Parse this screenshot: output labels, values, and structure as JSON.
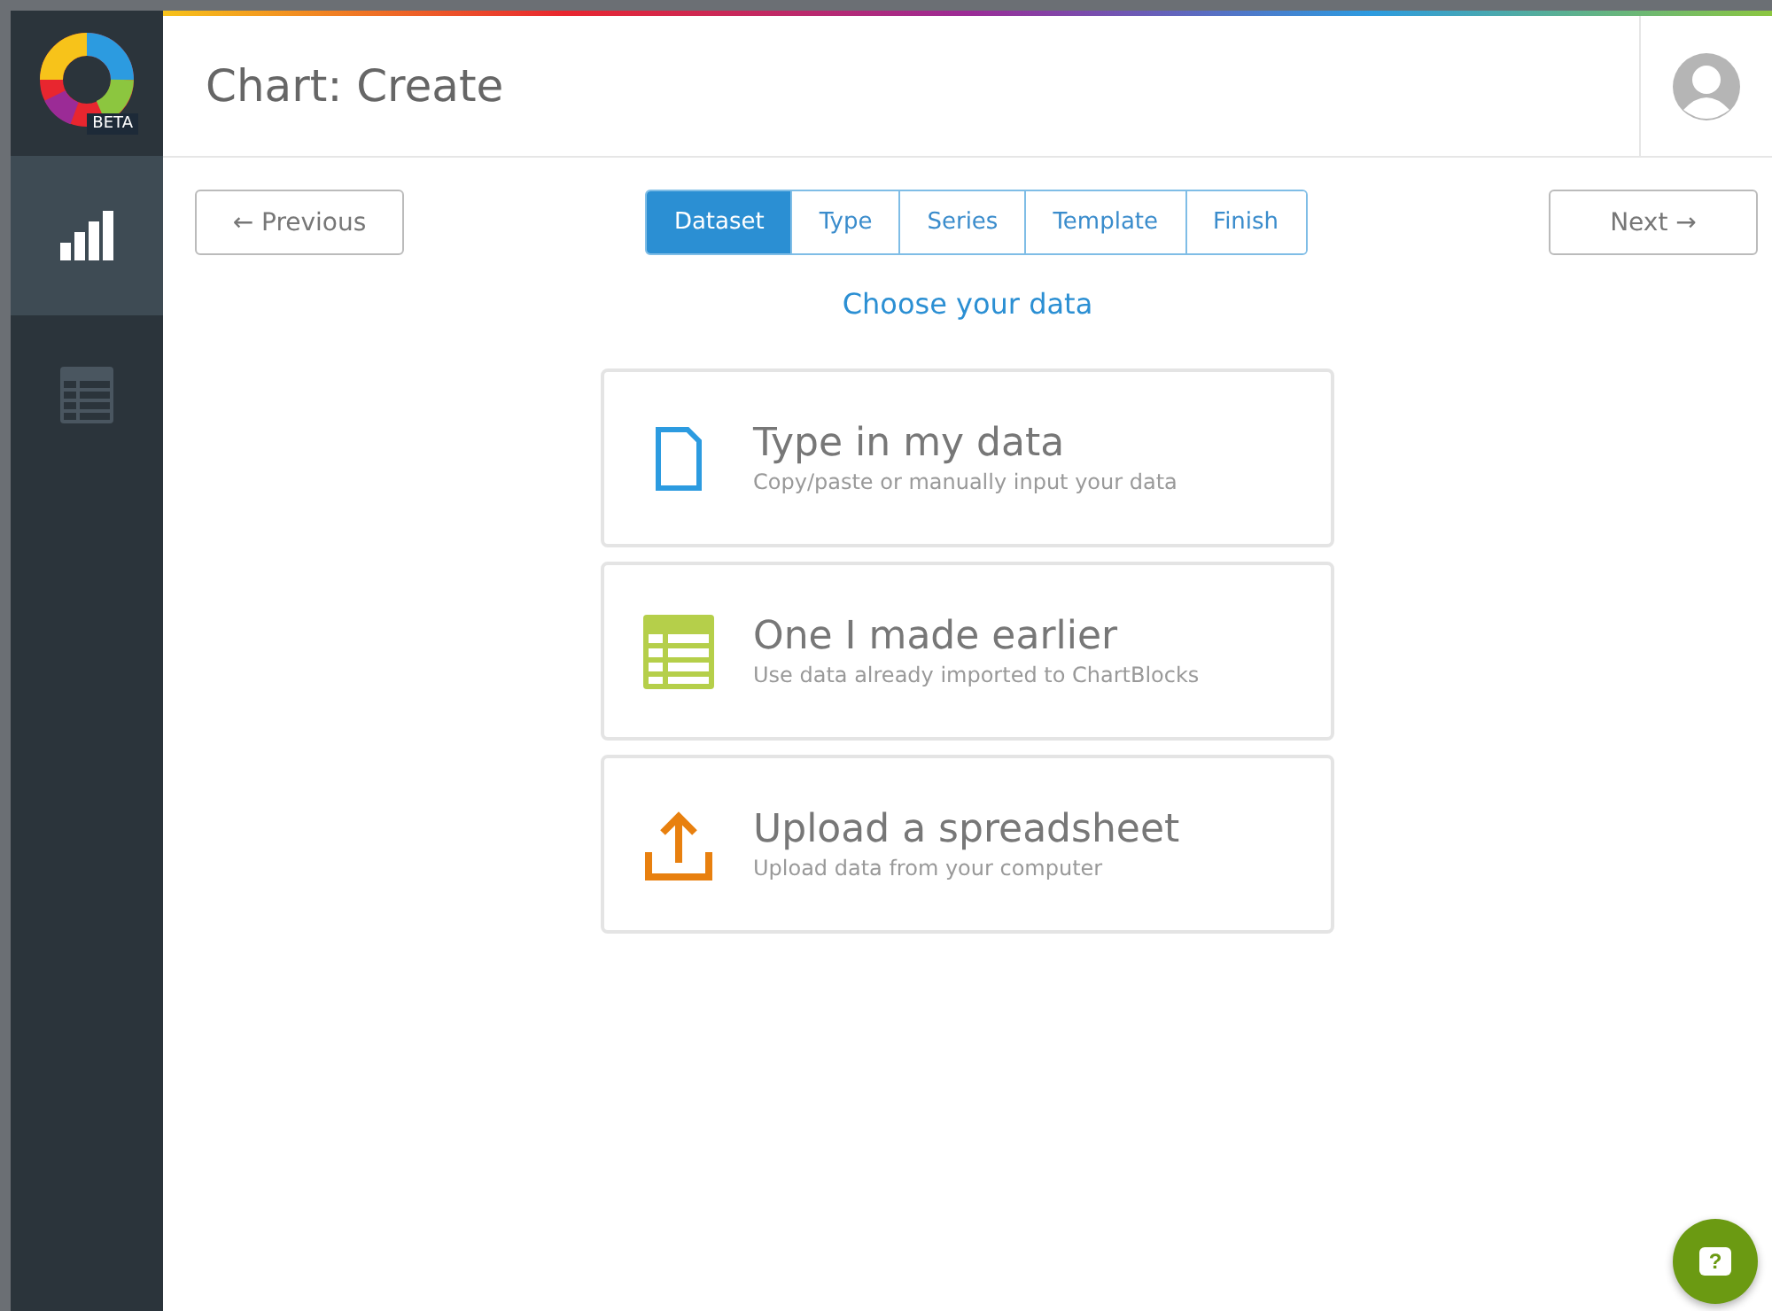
{
  "logo": {
    "badge": "BETA"
  },
  "sidebar": {
    "items": [
      {
        "kind": "chart",
        "selected": true
      },
      {
        "kind": "table",
        "selected": false
      }
    ]
  },
  "header": {
    "title": "Chart: Create"
  },
  "nav": {
    "previous": "← Previous",
    "next": "Next →"
  },
  "steps": [
    {
      "label": "Dataset",
      "selected": true
    },
    {
      "label": "Type",
      "selected": false
    },
    {
      "label": "Series",
      "selected": false
    },
    {
      "label": "Template",
      "selected": false
    },
    {
      "label": "Finish",
      "selected": false
    }
  ],
  "heading": "Choose your data",
  "options": [
    {
      "kind": "file",
      "title": "Type in my data",
      "subtitle": "Copy/paste or manually input your data"
    },
    {
      "kind": "table",
      "title": "One I made earlier",
      "subtitle": "Use data already imported to ChartBlocks"
    },
    {
      "kind": "upload",
      "title": "Upload a spreadsheet",
      "subtitle": "Upload data from your computer"
    }
  ],
  "help": {
    "label": "?"
  }
}
